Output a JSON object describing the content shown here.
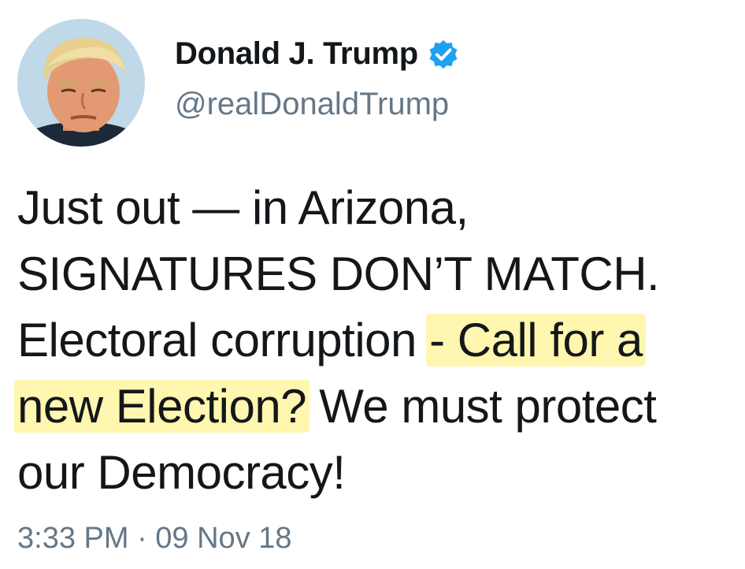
{
  "user": {
    "display_name": "Donald J. Trump",
    "handle": "@realDonaldTrump",
    "verified": true,
    "verified_icon": "verified-badge-icon",
    "avatar_icon": "profile-photo"
  },
  "tweet": {
    "line1": "Just out — in Arizona,",
    "line2": "SIGNATURES DON’T MATCH.",
    "line3_plain": "Electoral corruption ",
    "line3_highlight": "- Call for a",
    "line4_highlight": "new Election?",
    "line4_plain": " We must protect",
    "line5": "our Democracy!",
    "timestamp": "3:33 PM · 09 Nov 18"
  },
  "colors": {
    "text": "#14171a",
    "secondary_text": "#657786",
    "verified_blue": "#1da1f2",
    "highlight": "#fff06e"
  }
}
